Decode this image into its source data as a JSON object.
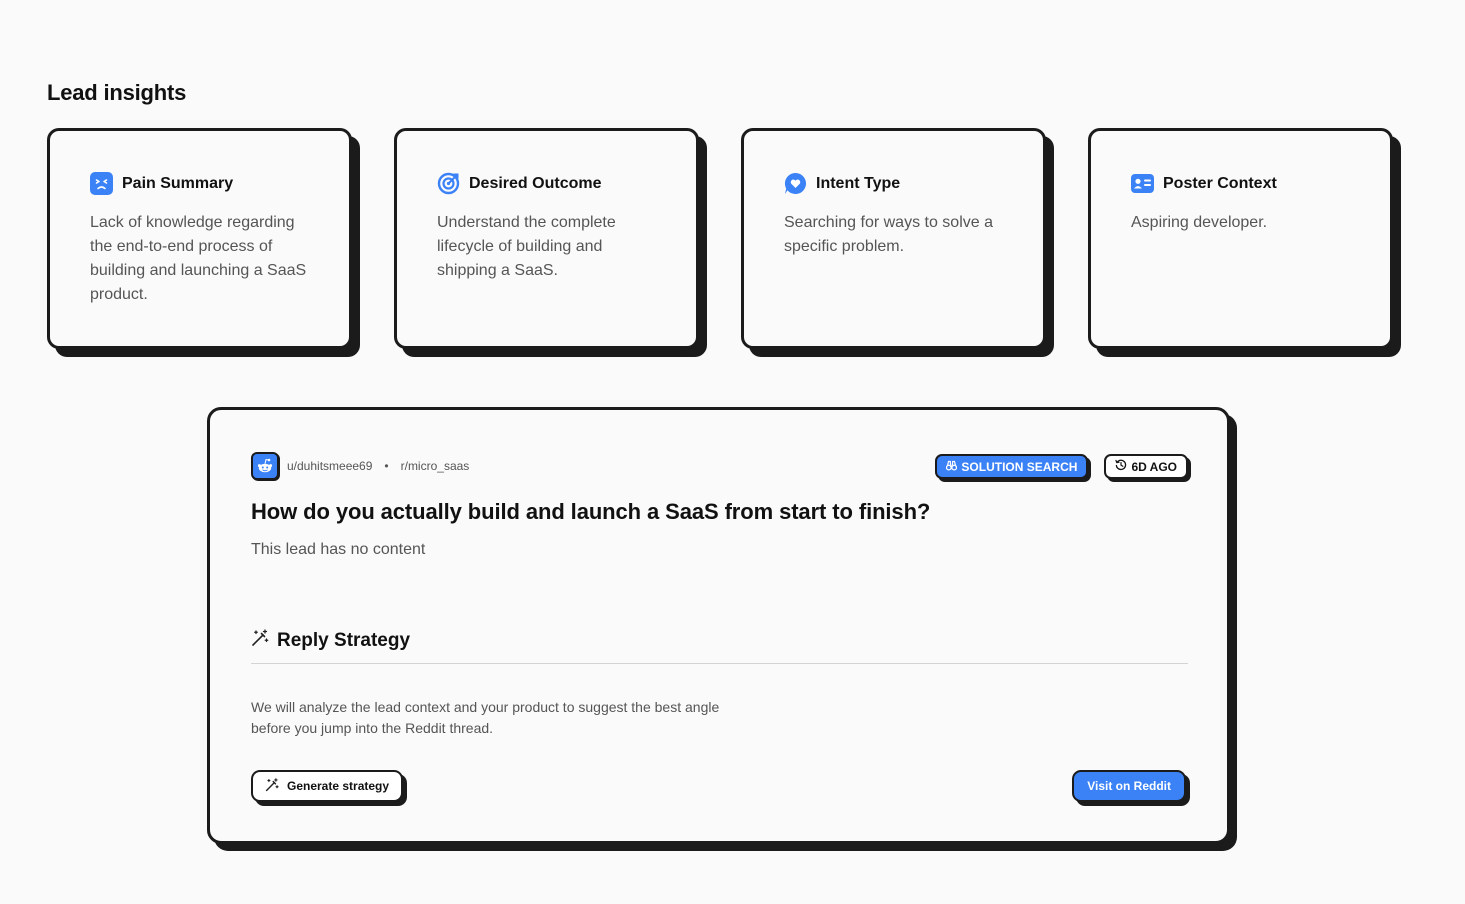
{
  "section": {
    "title": "Lead insights"
  },
  "insights": [
    {
      "icon": "frustrated-face-icon",
      "title": "Pain Summary",
      "body": "Lack of knowledge regarding the end-to-end process of building and launching a SaaS product."
    },
    {
      "icon": "target-icon",
      "title": "Desired Outcome",
      "body": "Understand the complete lifecycle of building and shipping a SaaS."
    },
    {
      "icon": "heart-chat-icon",
      "title": "Intent Type",
      "body": "Searching for ways to solve a specific problem."
    },
    {
      "icon": "id-card-icon",
      "title": "Poster Context",
      "body": "Aspiring developer."
    }
  ],
  "lead": {
    "source_icon": "reddit-icon",
    "author": "u/duhitsmeee69",
    "separator": "•",
    "subreddit": "r/micro_saas",
    "tag_intent": "SOLUTION SEARCH",
    "tag_age": "6D AGO",
    "title": "How do you actually build and launch a SaaS from start to finish?",
    "content": "This lead has no content",
    "strategy": {
      "title": "Reply Strategy",
      "text": "We will analyze the lead context and your product to suggest the best angle before you jump into the Reddit thread.",
      "generate_label": "Generate strategy",
      "visit_label": "Visit on Reddit"
    }
  },
  "colors": {
    "accent": "#3b82f6",
    "border": "#1b1b1b",
    "background": "#fafafa"
  }
}
